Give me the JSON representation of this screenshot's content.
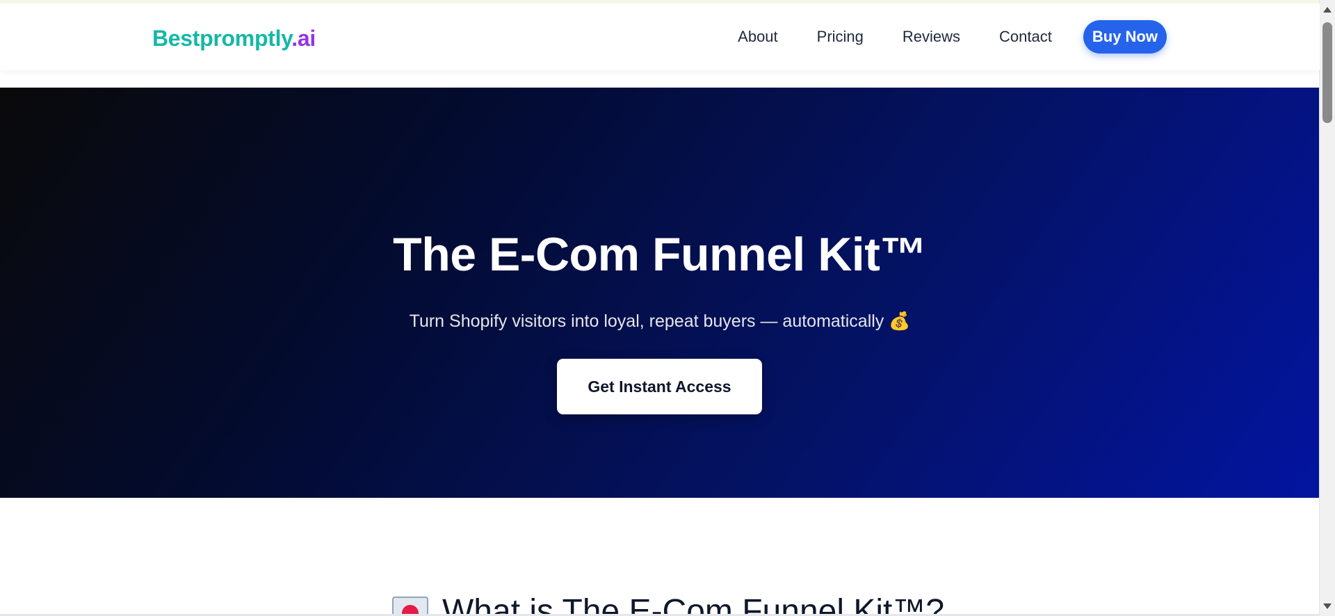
{
  "header": {
    "logo_main": "Bestpromptly",
    "logo_tld": ".ai",
    "nav": [
      "About",
      "Pricing",
      "Reviews",
      "Contact"
    ],
    "buy_label": "Buy Now"
  },
  "hero": {
    "title": "The E-Com Funnel Kit™",
    "subtitle": "Turn Shopify visitors into loyal, repeat buyers — automatically 💰",
    "cta_label": "Get Instant Access"
  },
  "section": {
    "icon": "love-letter-icon",
    "title": "What is The E-Com Funnel Kit™?"
  },
  "colors": {
    "logo_teal": "#14b8a6",
    "logo_purple": "#9333ea",
    "accent_blue": "#2563eb",
    "hero_dark": "#0a0a0a",
    "hero_blue": "#0314a0"
  }
}
